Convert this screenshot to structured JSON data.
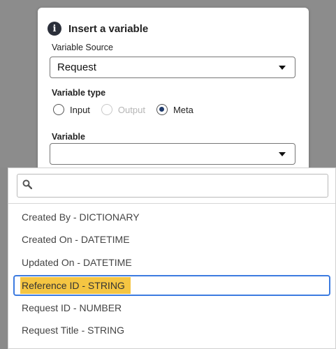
{
  "dialog": {
    "title": "Insert a variable",
    "source_label": "Variable Source",
    "source_value": "Request",
    "type_label": "Variable type",
    "type_options": [
      {
        "label": "Input",
        "checked": false,
        "disabled": false
      },
      {
        "label": "Output",
        "checked": false,
        "disabled": true
      },
      {
        "label": "Meta",
        "checked": true,
        "disabled": false
      }
    ],
    "variable_label": "Variable",
    "variable_value": ""
  },
  "dropdown": {
    "search_placeholder": "",
    "options": [
      {
        "label": "Created By - DICTIONARY",
        "selected": false
      },
      {
        "label": "Created On - DATETIME",
        "selected": false
      },
      {
        "label": "Updated On - DATETIME",
        "selected": false
      },
      {
        "label": "Reference ID - STRING",
        "selected": true
      },
      {
        "label": "Request ID - NUMBER",
        "selected": false
      },
      {
        "label": "Request Title - STRING",
        "selected": false
      }
    ]
  },
  "icons": {
    "info": "info-icon",
    "search": "search-icon",
    "caret": "caret-down-icon"
  },
  "colors": {
    "highlight": "#f5c542",
    "focus_border": "#3c7be0",
    "radio_checked": "#1f3a6b"
  }
}
